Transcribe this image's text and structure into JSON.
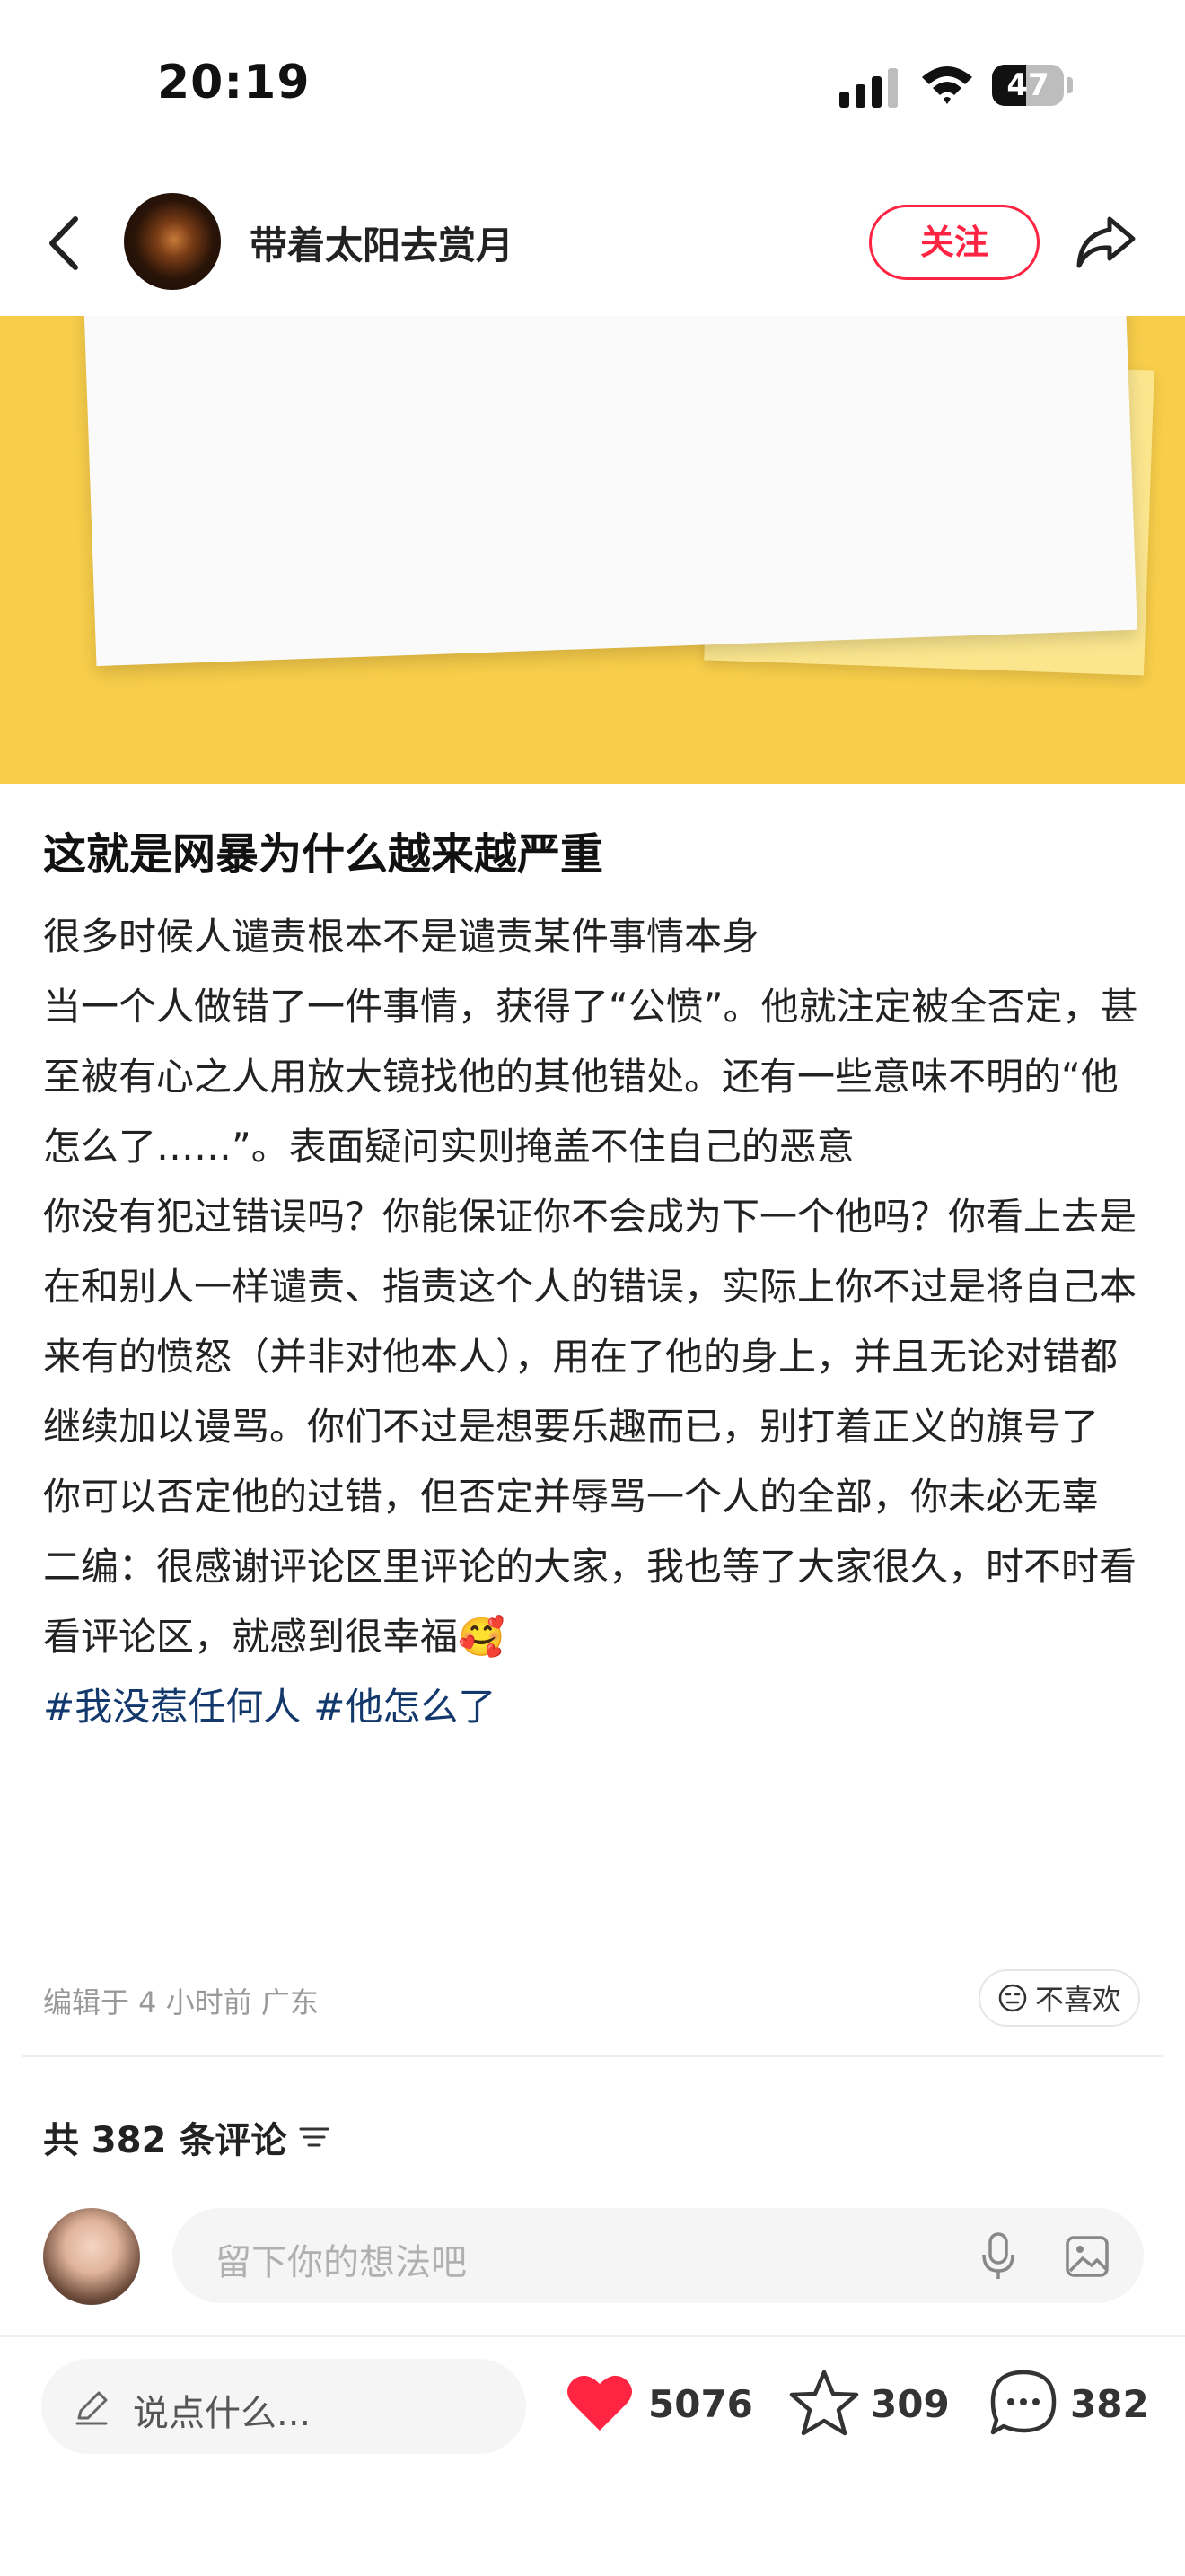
{
  "status_bar": {
    "time": "20:19",
    "battery": "47",
    "battery_level_percent": 47
  },
  "header": {
    "author": "带着太阳去赏月",
    "follow_label": "关注"
  },
  "post": {
    "title": "这就是网暴为什么越来越严重",
    "paragraphs": [
      "很多时候人谴责根本不是谴责某件事情本身",
      "当一个人做错了一件事情，获得了“公愤”。他就注定被全否定，甚至被有心之人用放大镜找他的其他错处。还有一些意味不明的“他怎么了……”。表面疑问实则掩盖不住自己的恶意",
      "你没有犯过错误吗？你能保证你不会成为下一个他吗？你看上去是在和别人一样谴责、指责这个人的错误，实际上你不过是将自己本来有的愤怒（并非对他本人），用在了他的身上，并且无论对错都继续加以谩骂。你们不过是想要乐趣而已，别打着正义的旗号了",
      "你可以否定他的过错，但否定并辱骂一个人的全部，你未必无辜",
      "二编：很感谢评论区里评论的大家，我也等了大家很久，时不时看看评论区，就感到很幸福🥰"
    ],
    "tags": [
      "#我没惹任何人",
      "#他怎么了"
    ],
    "meta": "编辑于 4 小时前 广东",
    "dislike_label": "不喜欢"
  },
  "comments": {
    "count_label": "共 382 条评论",
    "input_placeholder": "留下你的想法吧"
  },
  "bottom_bar": {
    "say_placeholder": "说点什么...",
    "likes": "5076",
    "favorites": "309",
    "comments": "382",
    "heart_color": "#ff2442"
  },
  "colors": {
    "accent": "#ff2442",
    "tag": "#13386c",
    "banner": "#f7cd4a"
  }
}
